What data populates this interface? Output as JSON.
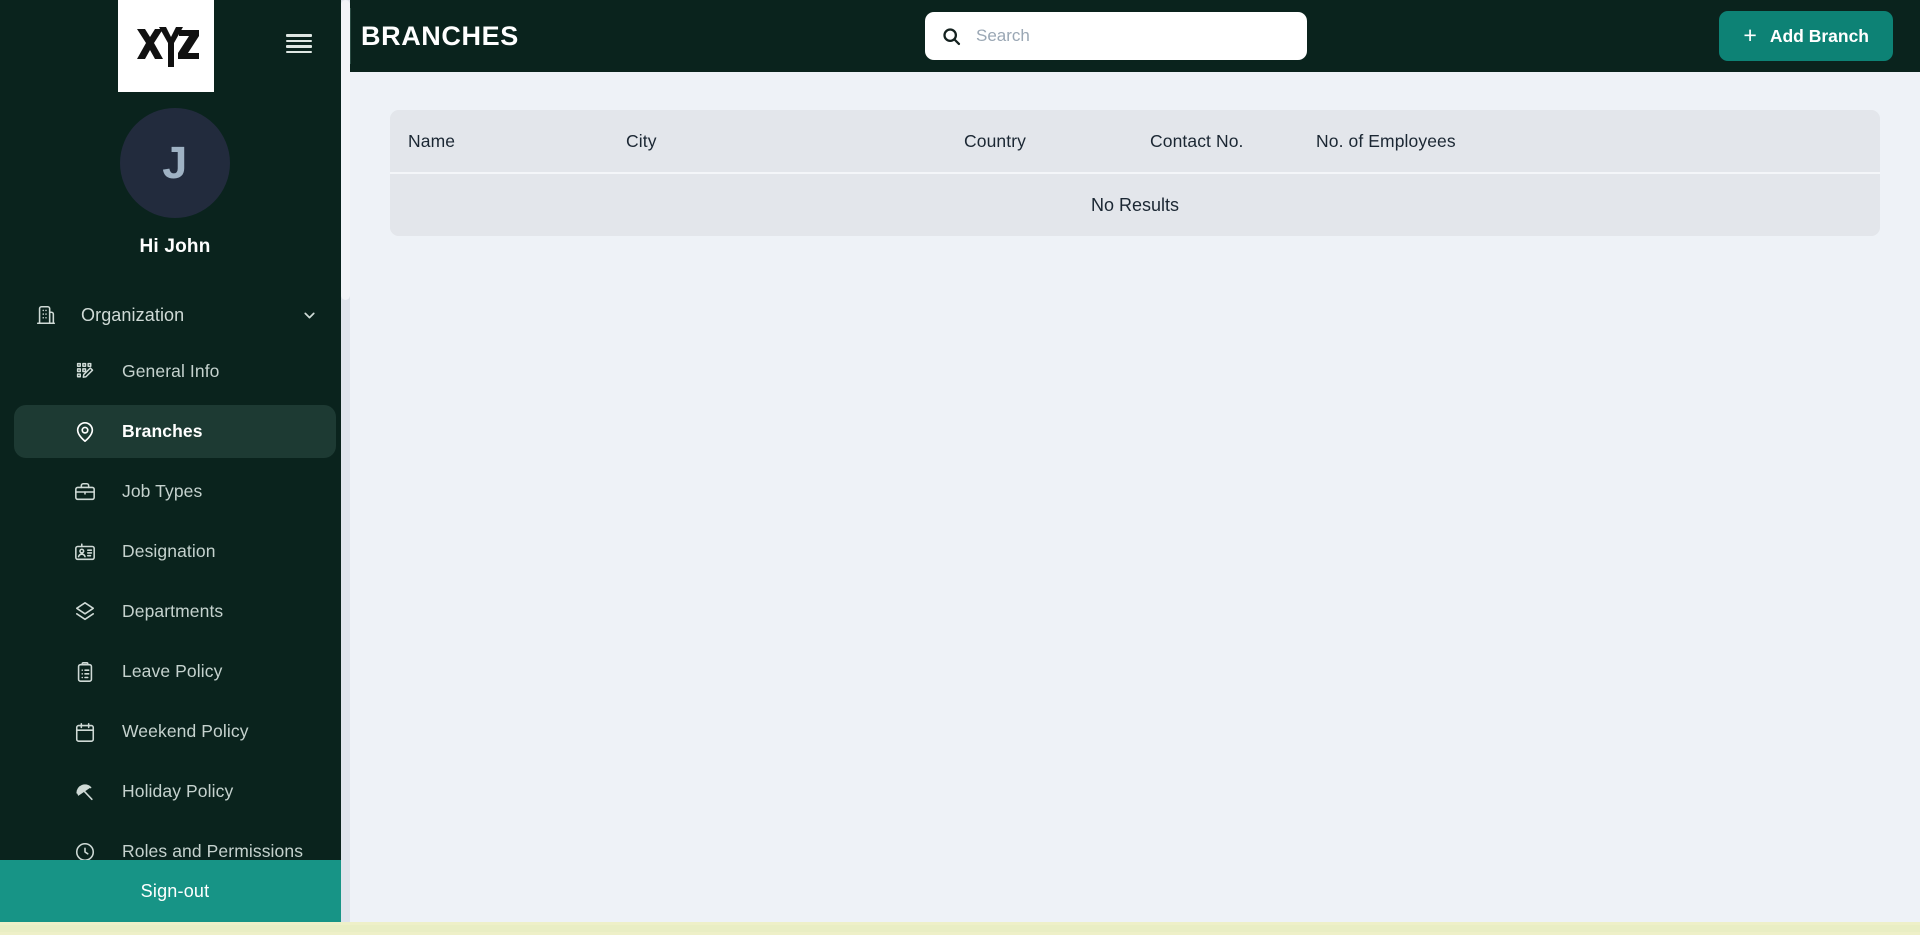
{
  "brand": {
    "logo_text": "XYZ",
    "logo_icon": "xyz-monogram-logo"
  },
  "sidebar": {
    "menu_icon": "hamburger-menu-icon",
    "avatar_initial": "J",
    "greeting": "Hi John",
    "group": {
      "label": "Organization",
      "icon": "building-icon",
      "chevron_icon": "chevron-down-icon"
    },
    "items": [
      {
        "label": "General Info",
        "icon": "grid-edit-icon",
        "active": false
      },
      {
        "label": "Branches",
        "icon": "map-pin-icon",
        "active": true
      },
      {
        "label": "Job Types",
        "icon": "briefcase-icon",
        "active": false
      },
      {
        "label": "Designation",
        "icon": "id-card-icon",
        "active": false
      },
      {
        "label": "Departments",
        "icon": "layers-icon",
        "active": false
      },
      {
        "label": "Leave Policy",
        "icon": "clipboard-list-icon",
        "active": false
      },
      {
        "label": "Weekend Policy",
        "icon": "calendar-icon",
        "active": false
      },
      {
        "label": "Holiday Policy",
        "icon": "umbrella-icon",
        "active": false
      },
      {
        "label": "Roles and Permissions",
        "icon": "shield-check-icon",
        "active": false
      }
    ],
    "signout_label": "Sign-out"
  },
  "header": {
    "title": "BRANCHES",
    "search": {
      "placeholder": "Search",
      "value": "",
      "icon": "search-icon"
    },
    "add_button": {
      "label": "Add Branch",
      "icon": "plus-icon"
    }
  },
  "table": {
    "columns": [
      "Name",
      "City",
      "Country",
      "Contact No.",
      "No. of Employees"
    ],
    "rows": [],
    "empty_message": "No Results"
  },
  "colors": {
    "sidebar_bg": "#0a231d",
    "accent_teal": "#0d8275",
    "signout_teal": "#179486",
    "active_item_bg": "#1d3a33",
    "page_bg": "#eef2f7",
    "table_bg": "#e3e6eb",
    "bottom_strip": "#eef0c8"
  }
}
